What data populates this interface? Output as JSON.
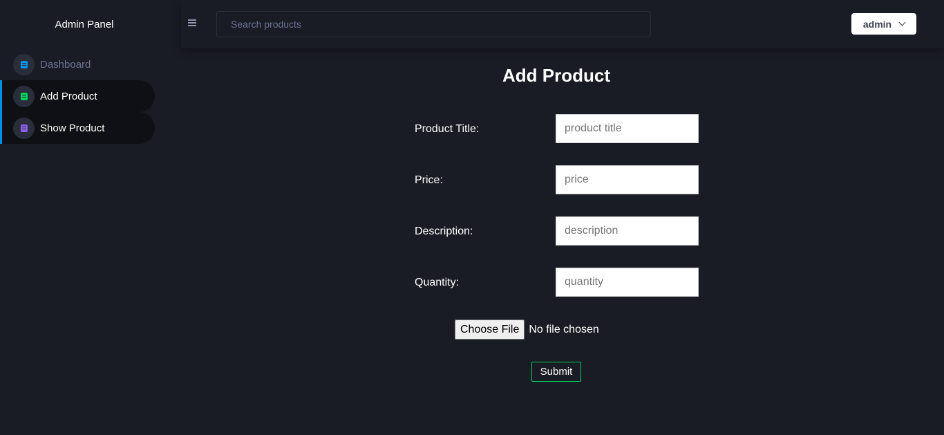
{
  "sidebar": {
    "brand": "Admin Panel",
    "items": [
      {
        "label": "Dashboard",
        "icon": "document-icon",
        "icon_color": "#0090e7"
      },
      {
        "label": "Add Product",
        "icon": "document-icon",
        "icon_color": "#00d25b"
      },
      {
        "label": "Show Product",
        "icon": "document-icon",
        "icon_color": "#8f5fe8"
      }
    ]
  },
  "topbar": {
    "search_placeholder": "Search products",
    "user_label": "admin"
  },
  "main": {
    "title": "Add Product",
    "fields": [
      {
        "label": "Product Title:",
        "placeholder": "product title",
        "value": ""
      },
      {
        "label": "Price:",
        "placeholder": "price",
        "value": ""
      },
      {
        "label": "Description:",
        "placeholder": "description",
        "value": ""
      },
      {
        "label": "Quantity:",
        "placeholder": "quantity",
        "value": ""
      }
    ],
    "file_button": "Choose File",
    "file_status": "No file chosen",
    "submit_label": "Submit"
  },
  "colors": {
    "background": "#1a1c25",
    "sidebar": "#191c24",
    "accent_blue": "#0090e7",
    "accent_green": "#00d25b",
    "accent_purple": "#8f5fe8"
  }
}
